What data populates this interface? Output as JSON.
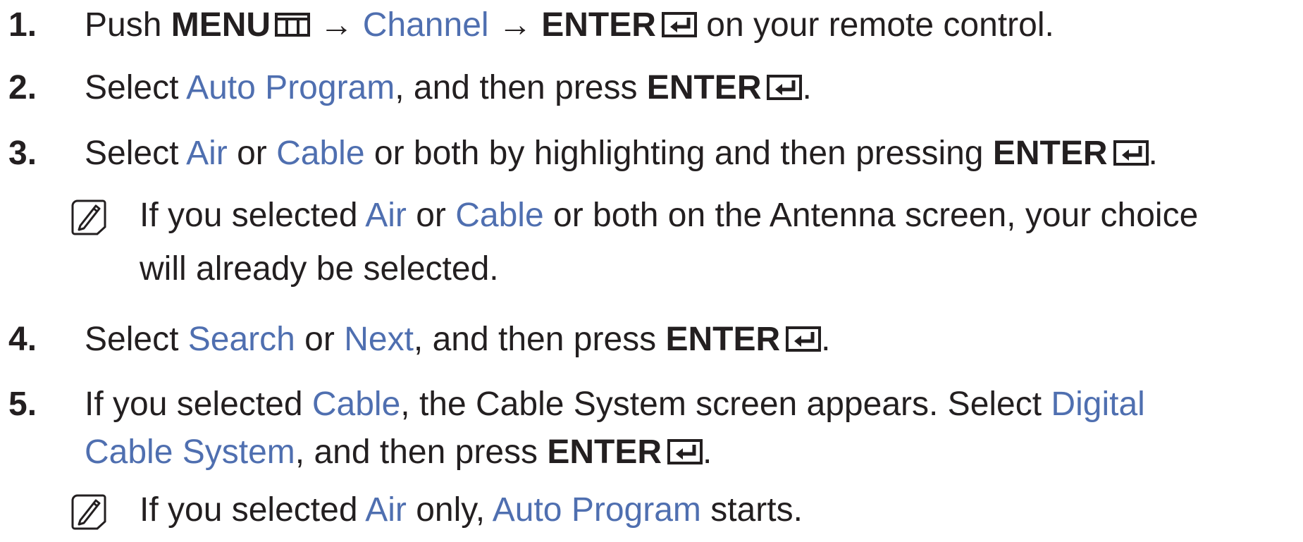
{
  "steps": [
    {
      "number": "1.",
      "parts": {
        "push": "Push ",
        "menu": "MENU",
        "arrow1": " → ",
        "channel": "Channel",
        "arrow2": " → ",
        "enter": "ENTER",
        "rest": " on your remote control."
      }
    },
    {
      "number": "2.",
      "parts": {
        "select": "Select ",
        "auto_program": "Auto Program",
        "mid": ", and then press ",
        "enter": "ENTER",
        "end": "."
      }
    },
    {
      "number": "3.",
      "parts": {
        "select": "Select ",
        "air": "Air",
        "or": " or ",
        "cable": "Cable",
        "mid": " or both by highlighting and then pressing ",
        "enter": "ENTER",
        "end": "."
      },
      "note": {
        "line1_a": "If you selected ",
        "air": "Air",
        "or": " or ",
        "cable": "Cable",
        "line1_b": " or both on the Antenna screen, your choice",
        "line2": "will already be selected."
      }
    },
    {
      "number": "4.",
      "parts": {
        "select": "Select ",
        "search": "Search",
        "or": " or ",
        "next": "Next",
        "mid": ", and then press ",
        "enter": "ENTER",
        "end": "."
      }
    },
    {
      "number": "5.",
      "parts": {
        "a": "If you selected ",
        "cable": "Cable",
        "b": ", the Cable System screen appears. Select ",
        "digital": "Digital",
        "cable_system": "Cable System",
        "c": ", and then press ",
        "enter": "ENTER",
        "end": "."
      },
      "note": {
        "a": "If you selected ",
        "air": "Air",
        "b": " only, ",
        "auto_program": "Auto Program",
        "c": " starts."
      }
    }
  ],
  "icons": {
    "menu": "menu-icon",
    "enter": "enter-icon",
    "note": "note-pencil-icon"
  },
  "colors": {
    "text": "#231f20",
    "highlight": "#4f6fb0"
  }
}
